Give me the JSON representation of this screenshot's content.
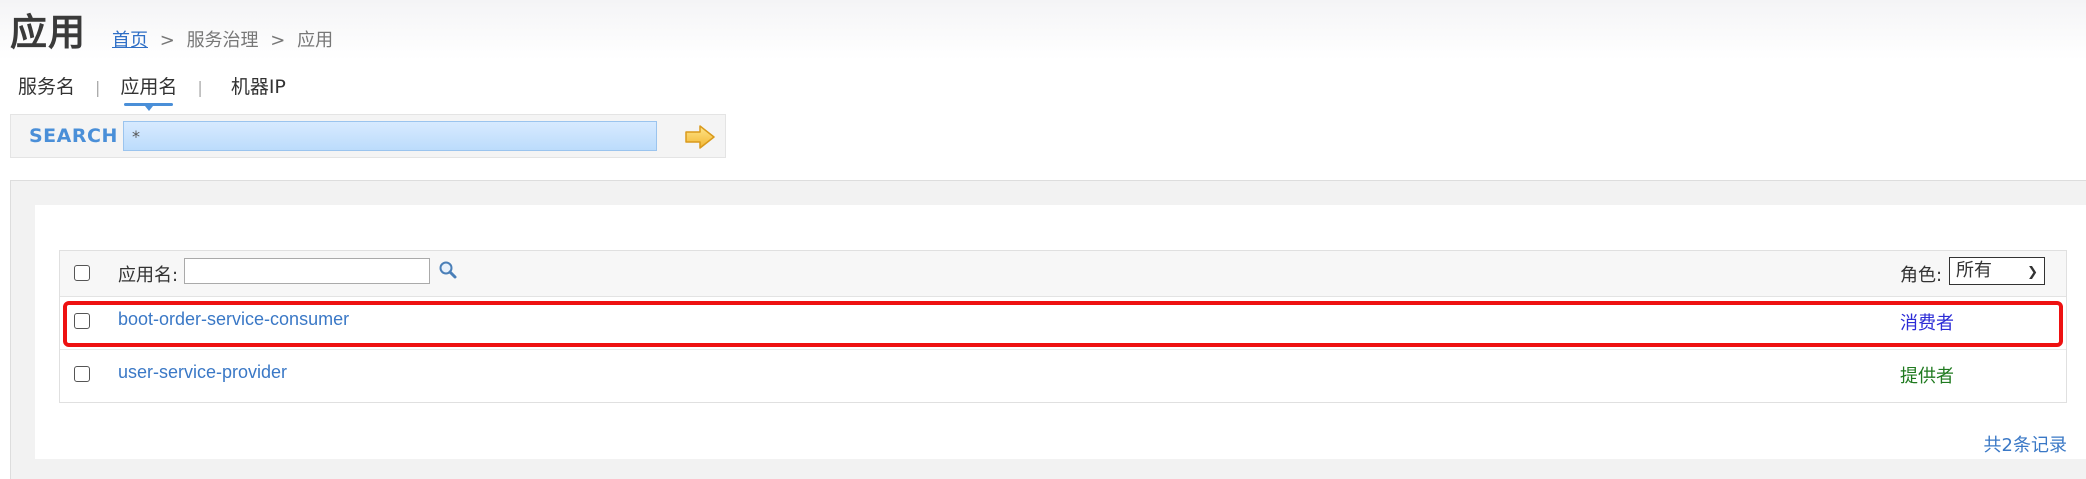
{
  "page_title": "应用",
  "breadcrumb": {
    "home": "首页",
    "separator": ">",
    "section": "服务治理",
    "current": "应用"
  },
  "tabs": [
    {
      "label": "服务名",
      "active": false
    },
    {
      "label": "应用名",
      "active": true
    },
    {
      "label": "机器IP",
      "active": false
    }
  ],
  "tab_divider": "|",
  "search": {
    "label": "SEARCH",
    "value": "*",
    "go_icon": "arrow-right-icon"
  },
  "grid": {
    "header": {
      "app_label": "应用名:",
      "filter_value": "",
      "filter_icon": "search-icon",
      "role_label": "角色:",
      "role_selected": "所有"
    },
    "rows": [
      {
        "app": "boot-order-service-consumer",
        "role": "消费者",
        "role_type": "consumer",
        "highlighted": true
      },
      {
        "app": "user-service-provider",
        "role": "提供者",
        "role_type": "provider",
        "highlighted": false
      }
    ],
    "record_count": "共2条记录"
  },
  "colors": {
    "accent": "#4a8fd8",
    "link": "#3a78c6",
    "consumer": "#2b2bd6",
    "provider": "#1f7a1f",
    "highlight": "#ee1111"
  }
}
